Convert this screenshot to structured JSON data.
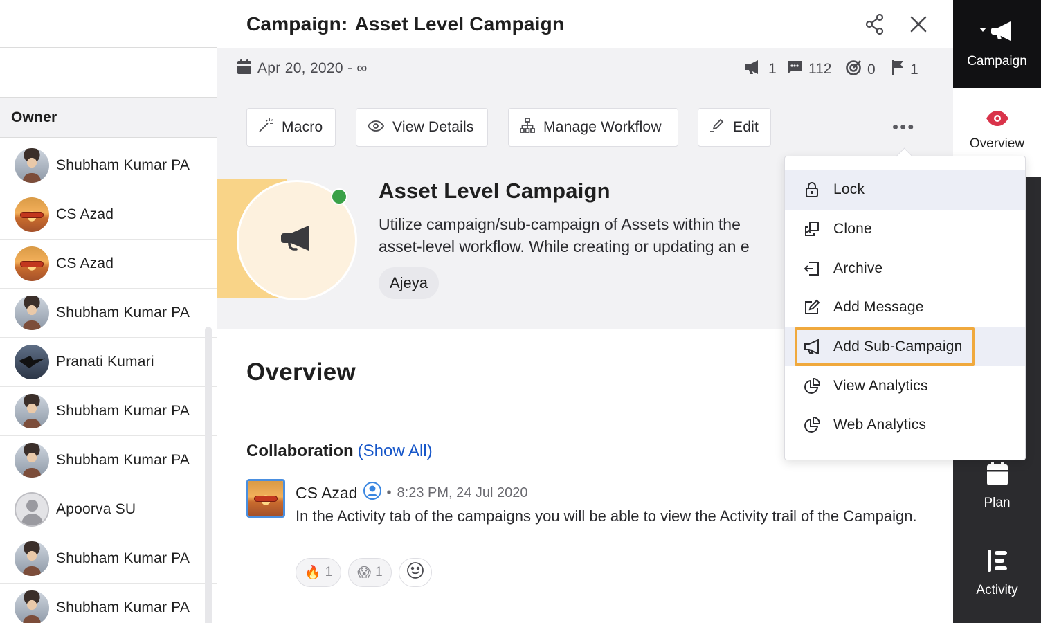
{
  "left_panel": {
    "column_header": "Owner",
    "rows": [
      {
        "name": "Shubham Kumar PA",
        "avatar": "man"
      },
      {
        "name": "CS Azad",
        "avatar": "sunset"
      },
      {
        "name": "CS Azad",
        "avatar": "sunset"
      },
      {
        "name": "Shubham Kumar PA",
        "avatar": "man"
      },
      {
        "name": "Pranati Kumari",
        "avatar": "eagle"
      },
      {
        "name": "Shubham Kumar PA",
        "avatar": "man"
      },
      {
        "name": "Shubham Kumar PA",
        "avatar": "man"
      },
      {
        "name": "Apoorva SU",
        "avatar": "default"
      },
      {
        "name": "Shubham Kumar PA",
        "avatar": "man"
      },
      {
        "name": "Shubham Kumar PA",
        "avatar": "man"
      }
    ]
  },
  "header": {
    "title_prefix": "Campaign:",
    "title": "Asset Level Campaign"
  },
  "meta": {
    "date_range": "Apr 20, 2020 - ∞",
    "stats": {
      "sub_campaigns": "1",
      "messages": "112",
      "goals": "0",
      "flags": "1"
    }
  },
  "actions": {
    "macro": "Macro",
    "view_details": "View Details",
    "manage_workflow": "Manage Workflow",
    "edit": "Edit",
    "more": "•••"
  },
  "hero": {
    "name": "Asset Level Campaign",
    "description_line1": "Utilize campaign/sub-campaign of Assets within the",
    "description_line2": "asset-level workflow. While creating or updating an e",
    "tag": "Ajeya",
    "status_color": "#3aa148"
  },
  "overview": {
    "title": "Overview",
    "collab_title": "Collaboration",
    "show_all": "(Show All)",
    "comment": {
      "author": "CS Azad",
      "time": "8:23 PM, 24 Jul 2020",
      "text": "In the Activity tab of the campaigns you will be able to view the Activity trail of the Campaign.",
      "reactions": [
        {
          "emoji": "🔥",
          "count": "1"
        },
        {
          "emoji": "😱",
          "count": "1"
        }
      ]
    }
  },
  "menu": {
    "items": [
      {
        "label": "Lock",
        "icon": "lock-icon"
      },
      {
        "label": "Clone",
        "icon": "clone-icon"
      },
      {
        "label": "Archive",
        "icon": "archive-icon"
      },
      {
        "label": "Add Message",
        "icon": "edit-square-icon"
      },
      {
        "label": "Add Sub-Campaign",
        "icon": "megaphone-icon"
      },
      {
        "label": "View Analytics",
        "icon": "pie-chart-icon"
      },
      {
        "label": "Web Analytics",
        "icon": "pie-chart-icon"
      }
    ],
    "highlight_color": "#f0a93d"
  },
  "rail": {
    "campaign": "Campaign",
    "overview": "Overview",
    "plan": "Plan",
    "activity": "Activity",
    "accent": "#d9334a"
  }
}
